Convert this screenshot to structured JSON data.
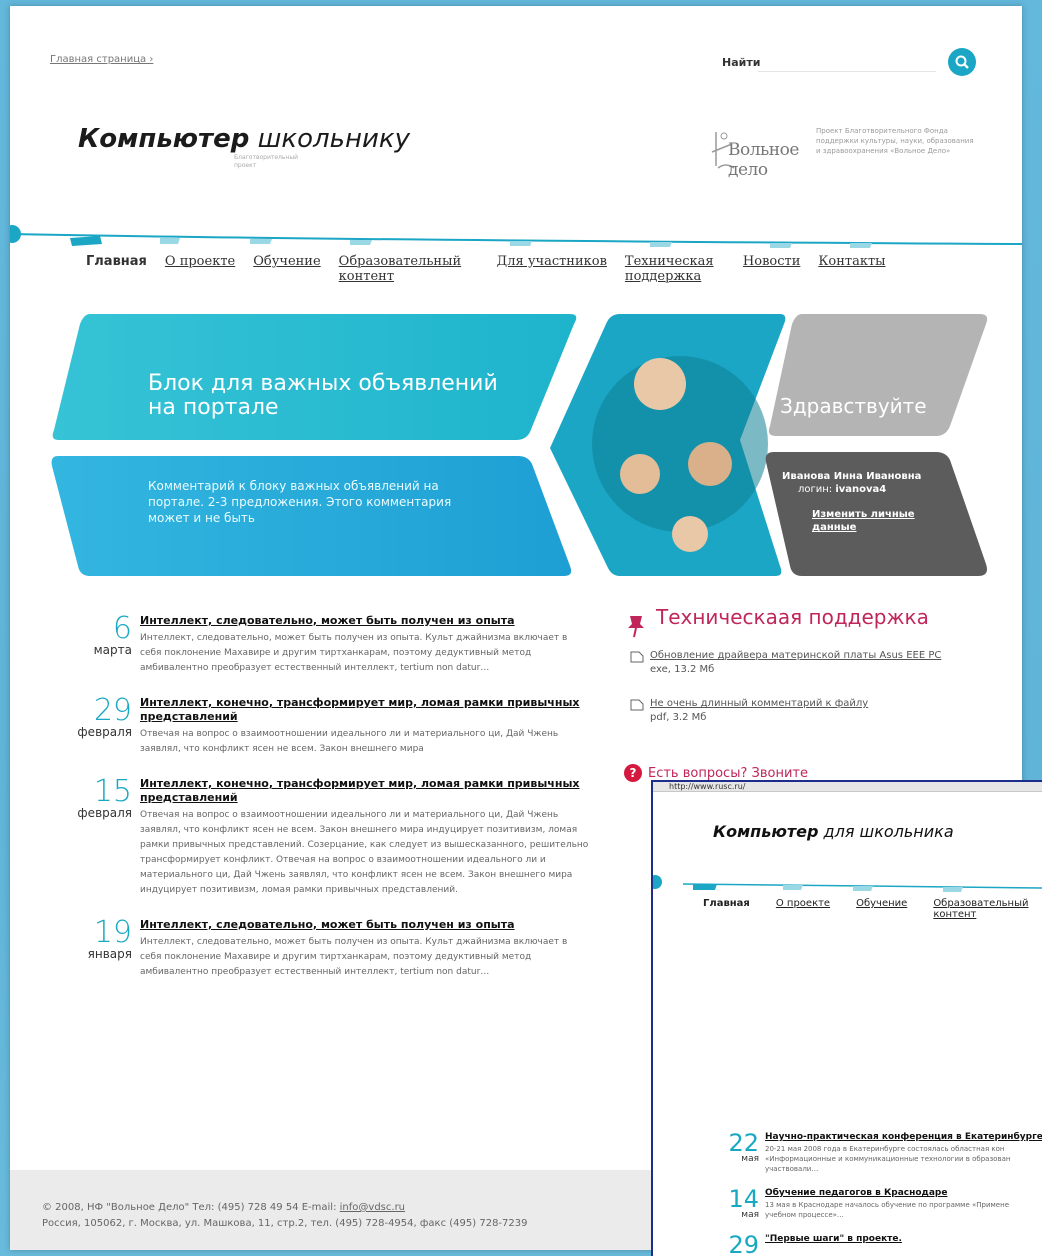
{
  "header": {
    "breadcrumb": "Главная страница ›",
    "search_label": "Найти",
    "search_placeholder": "",
    "logo_bold": "Компьютер",
    "logo_rest": "школьнику",
    "logo_subtitle": "Благотворительный проект",
    "partner_name": "Вольное дело",
    "partner_desc": "Проект Благотворительного Фонда поддержки культуры, науки, образования и здравоохранения «Вольное Дело»"
  },
  "nav": {
    "items": [
      "Главная",
      "О проекте",
      "Обучение",
      "Образовательный контент",
      "Для участников",
      "Техническая поддержка",
      "Новости",
      "Контакты"
    ]
  },
  "hero": {
    "title": "Блок для важных объявлений на портале",
    "comment": "Комментарий к блоку важных объявлений на портале. 2-3 предложения. Этого комментария может и не быть",
    "greeting": "Здравствуйте",
    "user_name": "Иванова Инна Ивановна",
    "login_label": "логин:",
    "login_value": "ivanova4",
    "edit_link": "Изменить личные данные"
  },
  "news": [
    {
      "day": "6",
      "month": "марта",
      "title": "Интеллект, следовательно, может быть получен из опыта",
      "text": "Интеллект, следовательно, может быть получен из опыта. Культ джайнизма включает в себя поклонение Махавире и другим тиртханкарам, поэтому дедуктивный метод амбивалентно преобразует естественный интеллект, tertium non datur…"
    },
    {
      "day": "29",
      "month": "февраля",
      "title": "Интеллект, конечно, трансформирует мир, ломая рамки привычных представлений",
      "text": "Отвечая на вопрос о взаимоотношении идеального ли и материального ци, Дай Чжень заявлял, что конфликт ясен не всем. Закон внешнего мира"
    },
    {
      "day": "15",
      "month": "февраля",
      "title": "Интеллект, конечно, трансформирует мир, ломая рамки привычных представлений",
      "text": "Отвечая на вопрос о взаимоотношении идеального ли и материального ци, Дай Чжень заявлял, что конфликт ясен не всем. Закон внешнего мира индуцирует позитивизм, ломая рамки привычных представлений. Созерцание, как следует из вышесказанного, решительно трансформирует конфликт. Отвечая на вопрос о взаимоотношении идеального ли и материального ци, Дай Чжень заявлял, что конфликт ясен не всем. Закон внешнего мира индуцирует позитивизм, ломая рамки привычных представлений."
    },
    {
      "day": "19",
      "month": "января",
      "title": "Интеллект, следовательно, может быть получен из опыта",
      "text": "Интеллект, следовательно, может быть получен из опыта. Культ джайнизма включает в себя поклонение Махавире и другим тиртханкарам, поэтому дедуктивный метод амбивалентно преобразует естественный интеллект, tertium non datur…"
    }
  ],
  "tech": {
    "title": "Техническаая поддержка",
    "files": [
      {
        "name": "Обновление драйвера материнской платы Asus EEE PC",
        "meta": "exe, 13.2 Мб"
      },
      {
        "name": "Не очень длинный комментарий к файлу",
        "meta": "pdf, 3.2 Мб"
      }
    ],
    "help": "Есть вопросы? Звоните"
  },
  "footer": {
    "line1_prefix": "© 2008, НФ \"Вольное Дело\" Тел: (495) 728 49 54 E-mail:",
    "email": "info@vdsc.ru",
    "line2": "Россия, 105062, г. Москва, ул. Машкова, 11, стр.2, тел. (495) 728-4954, факс (495) 728-7239"
  },
  "overlay": {
    "address": "http://www.rusc.ru/",
    "logo_bold": "Компьютер",
    "logo_rest": "для школьника",
    "nav": [
      "Главная",
      "О проекте",
      "Обучение",
      "Образовательный контент"
    ],
    "news": [
      {
        "day": "22",
        "month": "мая",
        "title": "Научно-практическая конференция в Екатеринбурге.",
        "text1": "20-21 мая 2008 года в Екатеринбурге состоялась областная кон",
        "text2": "«Информационные и коммуникационные технологии в образован",
        "text3": "участвовали…"
      },
      {
        "day": "14",
        "month": "мая",
        "title": "Обучение педагогов в Краснодаре",
        "text1": "13 мая в Краснодаре началось обучение по программе «Примене",
        "text2": "учебном процессе»…",
        "text3": ""
      },
      {
        "day": "29",
        "month": "",
        "title": "\"Первые шаги\" в проекте.",
        "text1": "",
        "text2": "",
        "text3": ""
      }
    ]
  },
  "colors": {
    "accent": "#18a8c2",
    "tech_title": "#c0265a",
    "hero_dark": "#5c5c5c"
  }
}
